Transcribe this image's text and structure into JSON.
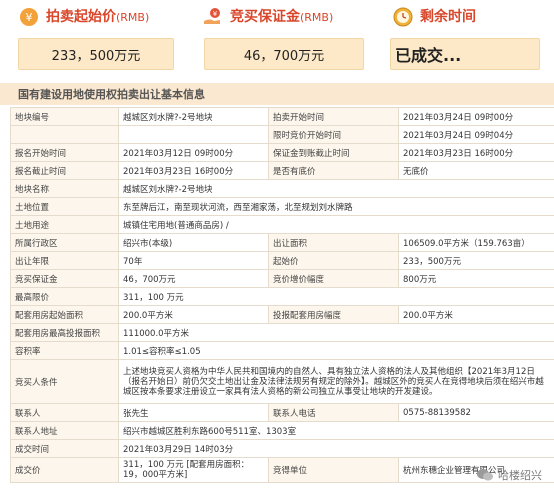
{
  "cards": {
    "start_price": {
      "title": "拍卖起始价",
      "unit": "(RMB)",
      "value": "233，500万元"
    },
    "deposit": {
      "title": "竞买保证金",
      "unit": "(RMB)",
      "value": "46，700万元"
    },
    "remaining": {
      "title": "剩余时间",
      "value": "已成交..."
    }
  },
  "section_title": "国有建设用地使用权拍卖出让基本信息",
  "rows": [
    {
      "c1": "地块编号",
      "c2": "越城区刘水牌?-2号地块",
      "c3": "拍卖开始时间",
      "c4": "2021年03月24日 09时00分"
    },
    {
      "c1": "",
      "c2": "",
      "c3": "限时竞价开始时间",
      "c4": "2021年03月24日 09时04分"
    },
    {
      "c1": "报名开始时间",
      "c2": "2021年03月12日 09时00分",
      "c3": "保证金到账截止时间",
      "c4": "2021年03月23日 16时00分"
    },
    {
      "c1": "报名截止时间",
      "c2": "2021年03月23日 16时00分",
      "c3": "是否有底价",
      "c4": "无底价"
    },
    {
      "c1": "地块名称",
      "c2": "越城区刘水牌?-2号地块"
    },
    {
      "c1": "土地位置",
      "c2": "东至牌后江，南至现状河流，西至湘家荡，北至规划刘水牌路"
    },
    {
      "c1": "土地用途",
      "c2": "城镇住宅用地(普通商品房) /"
    },
    {
      "c1": "所属行政区",
      "c2": "绍兴市(本级)",
      "c3": "出让面积",
      "c4": "106509.0平方米（159.763亩）"
    },
    {
      "c1": "出让年限",
      "c2": "70年",
      "c3": "起始价",
      "c4": "233，500万元"
    },
    {
      "c1": "竞买保证金",
      "c2": "46，700万元",
      "c3": "竞价增价幅度",
      "c4": "800万元"
    },
    {
      "c1": "最高限价",
      "c2": "311，100 万元"
    },
    {
      "c1": "配套用房起始面积",
      "c2": "200.0平方米",
      "c3": "投报配套用房幅度",
      "c4": "200.0平方米"
    },
    {
      "c1": "配套用房最高投报面积",
      "c2": "111000.0平方米"
    },
    {
      "c1": "容积率",
      "c2": "1.01≤容积率≤1.05"
    },
    {
      "c1": "竞买人条件",
      "c2": "上述地块竞买人资格为中华人民共和国境内的自然人、具有独立法人资格的法人及其他组织【2021年3月12日（报名开始日）前仍欠交土地出让金及法律法规另有规定的除外】。越城区外的竞买人在竞得地块后须在绍兴市越城区按本条要求注册设立一家具有法人资格的新公司独立从事受让地块的开发建设。"
    },
    {
      "c1": "联系人",
      "c2": "张先生",
      "c3": "联系人电话",
      "c4": "0575-88139582"
    },
    {
      "c1": "联系人地址",
      "c2": "绍兴市越城区胜利东路600号511室、1303室"
    },
    {
      "c1": "成交时间",
      "c2": "2021年03月29日 14时03分"
    },
    {
      "c1": "成交价",
      "c2": "311，100 万元 [配套用房面积：19，000平方米]",
      "c3": "竞得单位",
      "c4": "杭州东穗企业管理有限公司"
    }
  ],
  "watermark": "哈楼绍兴",
  "colors": {
    "accent": "#d9472b",
    "card_bg": "#fde9c8",
    "label_bg": "#fdf6ec",
    "section_bg": "#fbe8d0"
  }
}
